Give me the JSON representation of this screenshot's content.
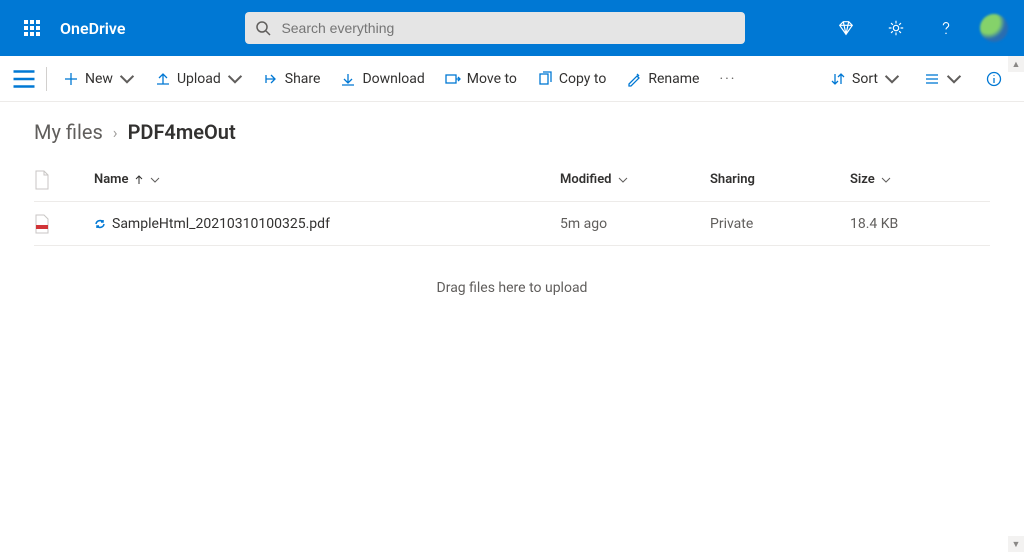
{
  "header": {
    "brand": "OneDrive",
    "search_placeholder": "Search everything"
  },
  "commandbar": {
    "new": "New",
    "upload": "Upload",
    "share": "Share",
    "download": "Download",
    "move": "Move to",
    "copy": "Copy to",
    "rename": "Rename",
    "sort": "Sort"
  },
  "breadcrumb": {
    "root": "My files",
    "current": "PDF4meOut"
  },
  "columns": {
    "name": "Name",
    "modified": "Modified",
    "sharing": "Sharing",
    "size": "Size"
  },
  "files": [
    {
      "name": "SampleHtml_20210310100325.pdf",
      "modified": "5m ago",
      "sharing": "Private",
      "size": "18.4 KB"
    }
  ],
  "dropzone": "Drag files here to upload"
}
